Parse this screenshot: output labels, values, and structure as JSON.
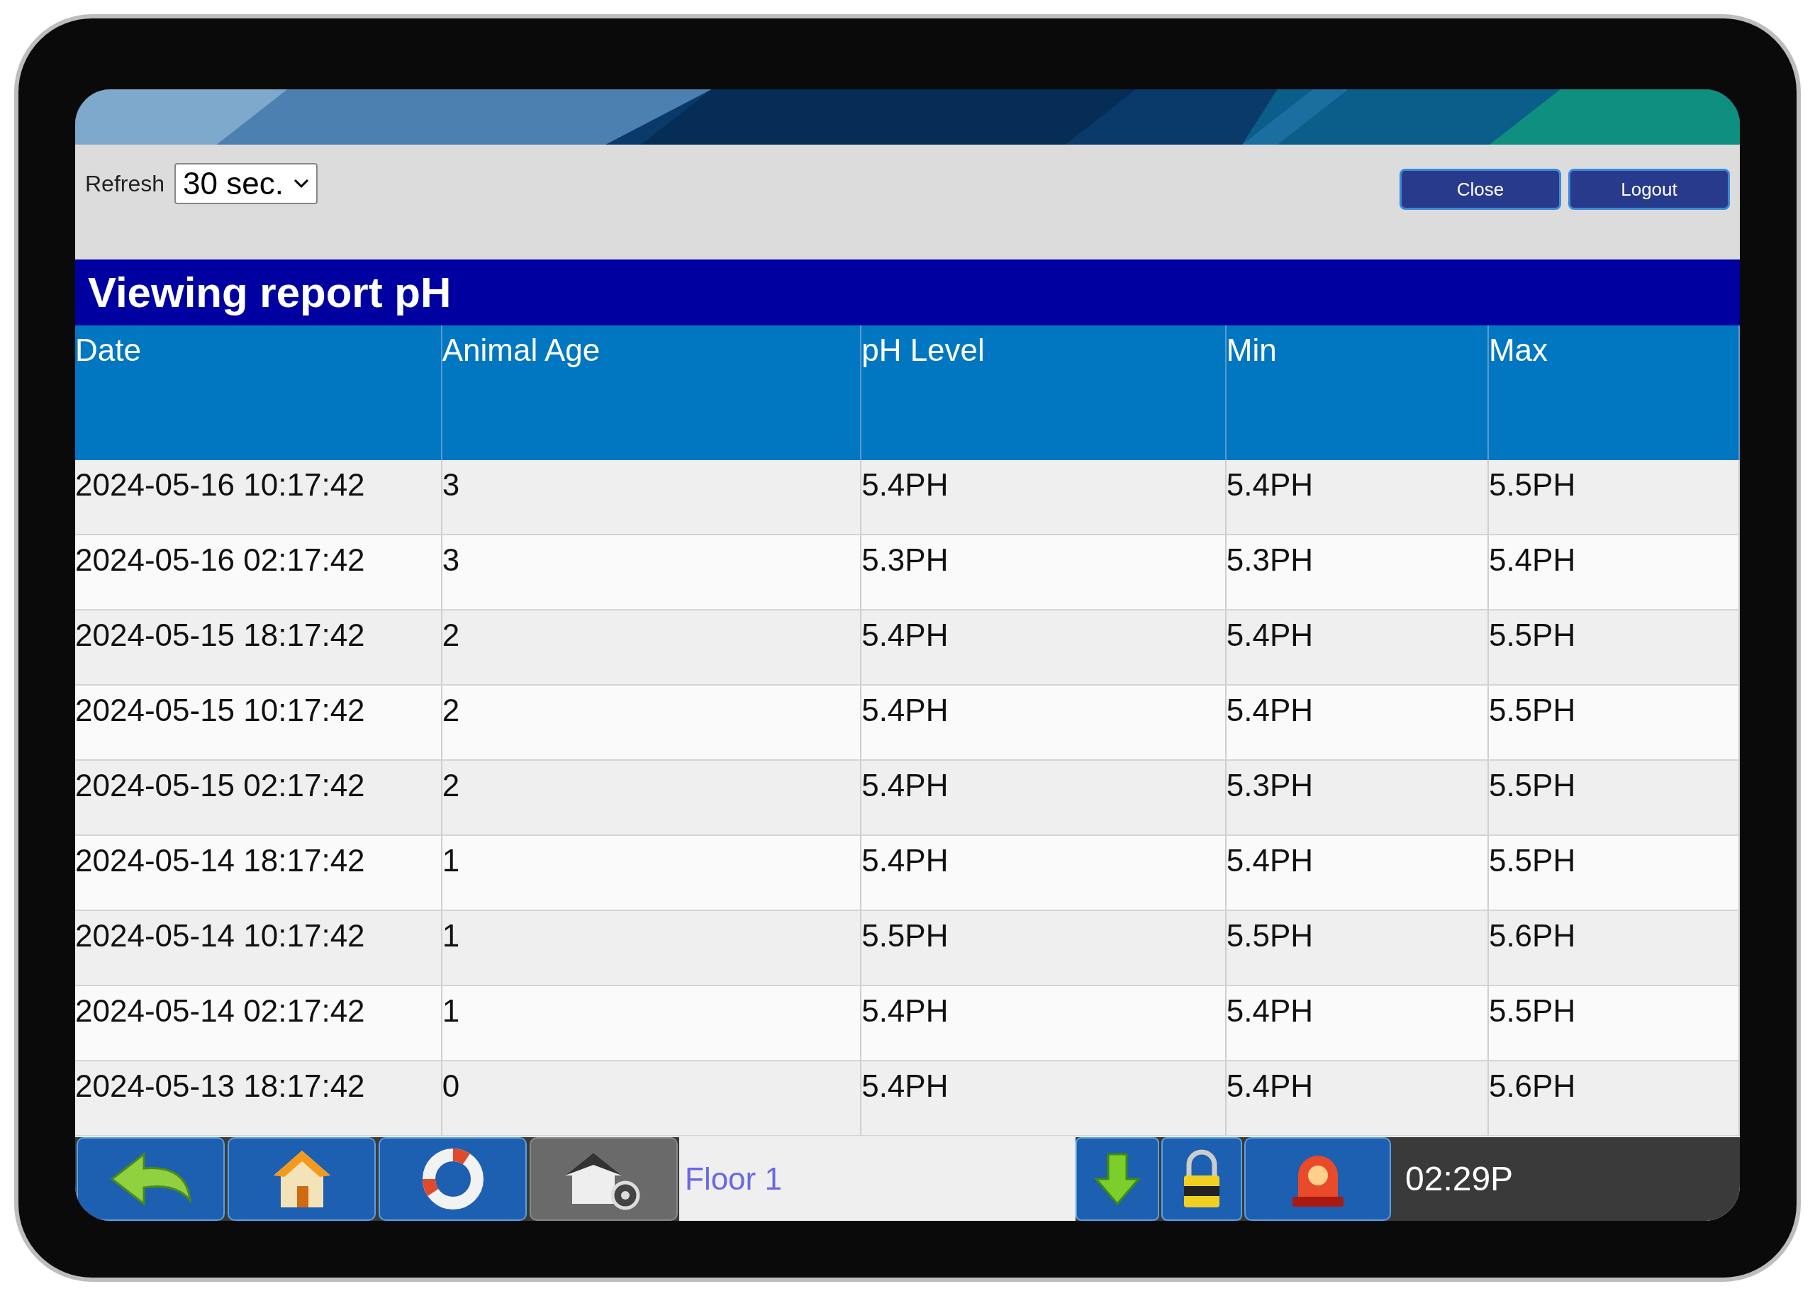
{
  "toolbar": {
    "refresh_label": "Refresh",
    "refresh_value": "30 sec.",
    "buttons": [
      "Close",
      "Logout"
    ]
  },
  "report": {
    "title": "Viewing report pH",
    "columns": [
      "Date",
      "Animal Age",
      "pH Level",
      "Min",
      "Max"
    ],
    "rows": [
      [
        "2024-05-16 10:17:42",
        "3",
        "5.4PH",
        "5.4PH",
        "5.5PH"
      ],
      [
        "2024-05-16 02:17:42",
        "3",
        "5.3PH",
        "5.3PH",
        "5.4PH"
      ],
      [
        "2024-05-15 18:17:42",
        "2",
        "5.4PH",
        "5.4PH",
        "5.5PH"
      ],
      [
        "2024-05-15 10:17:42",
        "2",
        "5.4PH",
        "5.4PH",
        "5.5PH"
      ],
      [
        "2024-05-15 02:17:42",
        "2",
        "5.4PH",
        "5.3PH",
        "5.5PH"
      ],
      [
        "2024-05-14 18:17:42",
        "1",
        "5.4PH",
        "5.4PH",
        "5.5PH"
      ],
      [
        "2024-05-14 10:17:42",
        "1",
        "5.5PH",
        "5.5PH",
        "5.6PH"
      ],
      [
        "2024-05-14 02:17:42",
        "1",
        "5.4PH",
        "5.4PH",
        "5.5PH"
      ],
      [
        "2024-05-13 18:17:42",
        "0",
        "5.4PH",
        "5.4PH",
        "5.6PH"
      ]
    ]
  },
  "bottom_bar": {
    "location": "Floor 1",
    "time": "02:29P"
  }
}
